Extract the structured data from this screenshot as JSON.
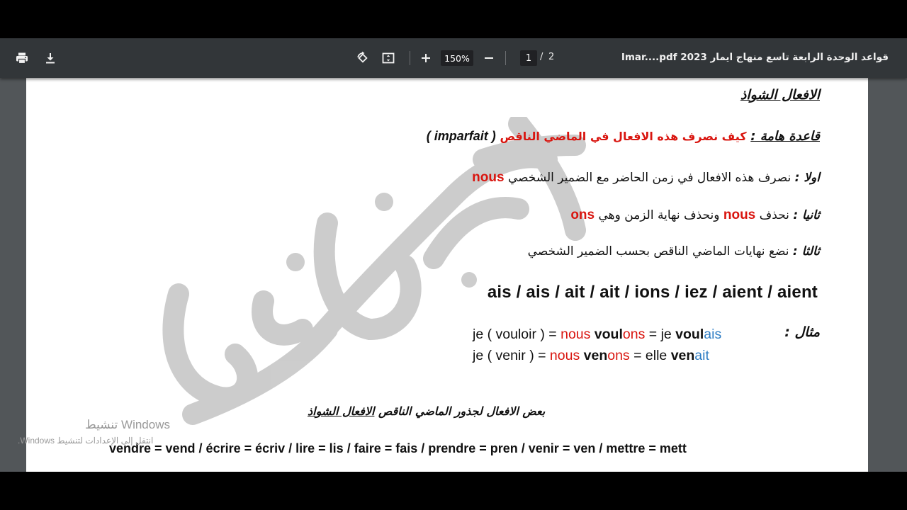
{
  "viewer": {
    "title": "قواعد الوحدة الرابعة تاسع منهاج ايمار 2023 Imar....pdf",
    "zoom": "150%",
    "current_page": "1",
    "page_separator": "/",
    "total_pages": "2",
    "icons": [
      "print-icon",
      "download-icon",
      "rotate-icon",
      "fit-page-icon",
      "zoom-in-icon",
      "zoom-out-icon"
    ]
  },
  "document": {
    "heading": "الافعال الشواذ",
    "rule_label": "قاعدة هامة :",
    "rule_question": "كيف نصرف هذه الافعال في الماضي الناقص",
    "rule_tense": "( imparfait )",
    "step1_label": "اولا :",
    "step1_text": "نصرف هذه الافعال في زمن الحاضر مع الضمير الشخصي",
    "step1_highlight": "nous",
    "step2_label": "ثانيا :",
    "step2_text_a": "نحذف",
    "step2_highlight_a": "nous",
    "step2_text_b": "ونحذف نهاية الزمن وهي",
    "step2_highlight_b": "ons",
    "step3_label": "ثالثا :",
    "step3_text": "نضع نهايات الماضي الناقص بحسب الضمير الشخصي",
    "endings": "ais  / ais / ait / ait / ions / iez / aient / aient",
    "example_label": "مثال :",
    "example1": {
      "a": "je ( vouloir )  = ",
      "b": "nous ",
      "c": "voul",
      "d": "ons",
      "e": "   =   je ",
      "f": "voul",
      "g": "ais"
    },
    "example2": {
      "a": "je ( venir )  =  ",
      "b": "nous ",
      "c": "ven",
      "d": "ons",
      "e": "  =  elle ",
      "f": "ven",
      "g": "ait"
    },
    "roots_heading_a": "بعض الافعال لجذور الماضي الناقص ",
    "roots_heading_b": "الافعال الشواذ",
    "roots_line": "vendre = vend  /  écrire = écriv  /  lire = lis  / faire = fais  /   prendre = pren  /  venir = ven  /  mettre = mett"
  },
  "watermark": {
    "text": "علي الخلف"
  },
  "os_overlay": {
    "activation_title": "تنشيط Windows",
    "activation_subtitle": "انتقل إلى الإعدادات لتنشيط Windows."
  },
  "colors": {
    "accent_red": "#d9150f",
    "accent_blue": "#2e7dc4",
    "toolbar_bg": "#323639",
    "viewer_bg": "#525659"
  }
}
